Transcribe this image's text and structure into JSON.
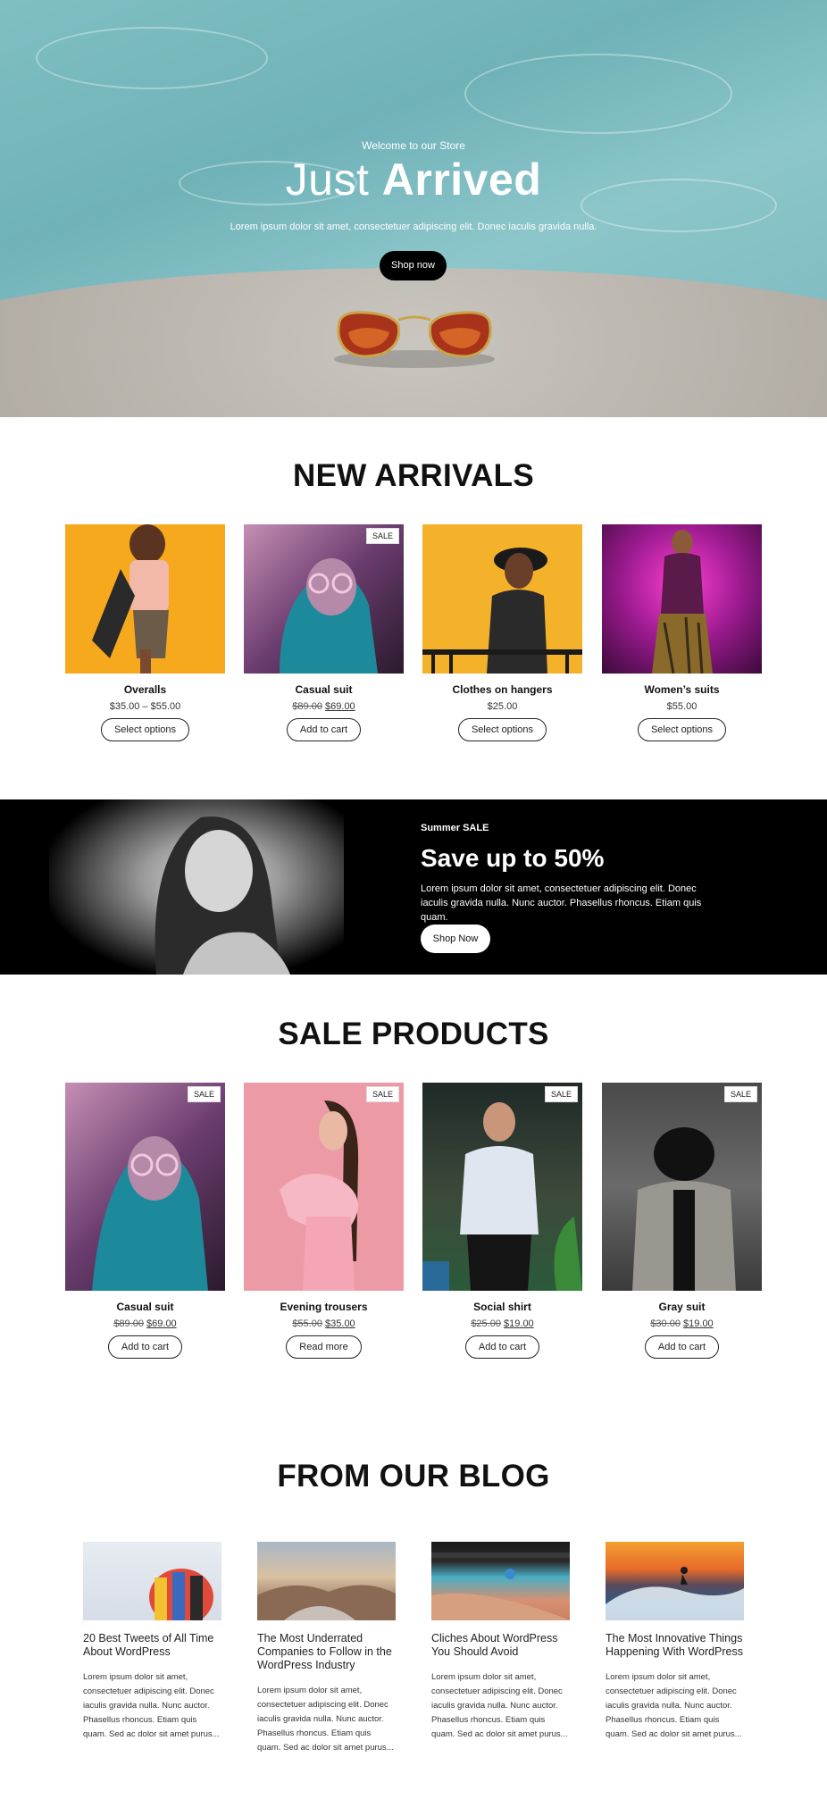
{
  "hero": {
    "kicker": "Welcome to our Store",
    "title_light": "Just",
    "title_bold": "Arrived",
    "description": "Lorem ipsum dolor sit amet, consectetuer adipiscing elit. Donec iaculis gravida nulla.",
    "button": "Shop now"
  },
  "new_arrivals": {
    "title": "NEW ARRIVALS",
    "products": [
      {
        "name": "Overalls",
        "price": "$35.00 – $55.00",
        "old_price": "",
        "sale": "",
        "button": "Select options"
      },
      {
        "name": "Casual suit",
        "price": "$69.00",
        "old_price": "$89.00",
        "sale": "SALE",
        "button": "Add to cart"
      },
      {
        "name": "Clothes on hangers",
        "price": "$25.00",
        "old_price": "",
        "sale": "",
        "button": "Select options"
      },
      {
        "name": "Women’s suits",
        "price": "$55.00",
        "old_price": "",
        "sale": "",
        "button": "Select options"
      }
    ]
  },
  "promo": {
    "kicker": "Summer SALE",
    "title": "Save up to 50%",
    "description": "Lorem ipsum dolor sit amet, consectetuer adipiscing elit. Donec iaculis gravida nulla. Nunc auctor. Phasellus rhoncus. Etiam quis quam.",
    "button": "Shop Now"
  },
  "sale_products": {
    "title": "SALE PRODUCTS",
    "products": [
      {
        "name": "Casual suit",
        "price": "$69.00",
        "old_price": "$89.00",
        "sale": "SALE",
        "button": "Add to cart"
      },
      {
        "name": "Evening trousers",
        "price": "$35.00",
        "old_price": "$55.00",
        "sale": "SALE",
        "button": "Read more"
      },
      {
        "name": "Social shirt",
        "price": "$19.00",
        "old_price": "$25.00",
        "sale": "SALE",
        "button": "Add to cart"
      },
      {
        "name": "Gray suit",
        "price": "$19.00",
        "old_price": "$30.00",
        "sale": "SALE",
        "button": "Add to cart"
      }
    ]
  },
  "blog": {
    "title": "FROM OUR BLOG",
    "posts": [
      {
        "title": "20 Best Tweets of All Time About WordPress",
        "excerpt": "Lorem ipsum dolor sit amet, consectetuer adipiscing elit. Donec iaculis gravida nulla. Nunc auctor. Phasellus rhoncus. Etiam quis quam. Sed ac dolor sit amet purus..."
      },
      {
        "title": "The Most Underrated Companies to Follow in the WordPress Industry",
        "excerpt": "Lorem ipsum dolor sit amet, consectetuer adipiscing elit. Donec iaculis gravida nulla. Nunc auctor. Phasellus rhoncus. Etiam quis quam. Sed ac dolor sit amet purus..."
      },
      {
        "title": "Cliches About WordPress You Should Avoid",
        "excerpt": "Lorem ipsum dolor sit amet, consectetuer adipiscing elit. Donec iaculis gravida nulla. Nunc auctor. Phasellus rhoncus. Etiam quis quam. Sed ac dolor sit amet purus..."
      },
      {
        "title": "The Most Innovative Things Happening With WordPress",
        "excerpt": "Lorem ipsum dolor sit amet, consectetuer adipiscing elit. Donec iaculis gravida nulla. Nunc auctor. Phasellus rhoncus. Etiam quis quam. Sed ac dolor sit amet purus..."
      }
    ]
  }
}
